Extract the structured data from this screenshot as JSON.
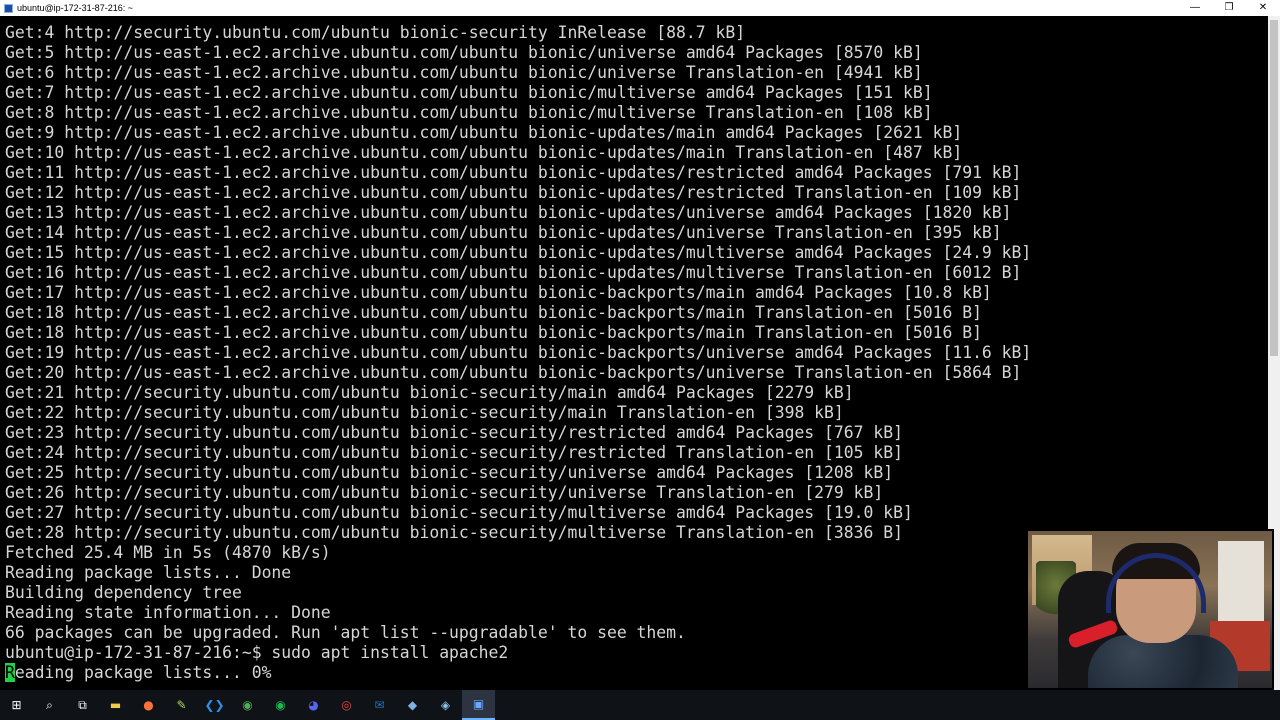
{
  "window": {
    "title": "ubuntu@ip-172-31-87-216: ~",
    "minimize": "—",
    "maximize": "❐",
    "close": "✕"
  },
  "terminal": {
    "lines": [
      "Get:4 http://security.ubuntu.com/ubuntu bionic-security InRelease [88.7 kB]",
      "Get:5 http://us-east-1.ec2.archive.ubuntu.com/ubuntu bionic/universe amd64 Packages [8570 kB]",
      "Get:6 http://us-east-1.ec2.archive.ubuntu.com/ubuntu bionic/universe Translation-en [4941 kB]",
      "Get:7 http://us-east-1.ec2.archive.ubuntu.com/ubuntu bionic/multiverse amd64 Packages [151 kB]",
      "Get:8 http://us-east-1.ec2.archive.ubuntu.com/ubuntu bionic/multiverse Translation-en [108 kB]",
      "Get:9 http://us-east-1.ec2.archive.ubuntu.com/ubuntu bionic-updates/main amd64 Packages [2621 kB]",
      "Get:10 http://us-east-1.ec2.archive.ubuntu.com/ubuntu bionic-updates/main Translation-en [487 kB]",
      "Get:11 http://us-east-1.ec2.archive.ubuntu.com/ubuntu bionic-updates/restricted amd64 Packages [791 kB]",
      "Get:12 http://us-east-1.ec2.archive.ubuntu.com/ubuntu bionic-updates/restricted Translation-en [109 kB]",
      "Get:13 http://us-east-1.ec2.archive.ubuntu.com/ubuntu bionic-updates/universe amd64 Packages [1820 kB]",
      "Get:14 http://us-east-1.ec2.archive.ubuntu.com/ubuntu bionic-updates/universe Translation-en [395 kB]",
      "Get:15 http://us-east-1.ec2.archive.ubuntu.com/ubuntu bionic-updates/multiverse amd64 Packages [24.9 kB]",
      "Get:16 http://us-east-1.ec2.archive.ubuntu.com/ubuntu bionic-updates/multiverse Translation-en [6012 B]",
      "Get:17 http://us-east-1.ec2.archive.ubuntu.com/ubuntu bionic-backports/main amd64 Packages [10.8 kB]",
      "Get:18 http://us-east-1.ec2.archive.ubuntu.com/ubuntu bionic-backports/main Translation-en [5016 B]",
      "Get:18 http://us-east-1.ec2.archive.ubuntu.com/ubuntu bionic-backports/main Translation-en [5016 B]",
      "Get:19 http://us-east-1.ec2.archive.ubuntu.com/ubuntu bionic-backports/universe amd64 Packages [11.6 kB]",
      "Get:20 http://us-east-1.ec2.archive.ubuntu.com/ubuntu bionic-backports/universe Translation-en [5864 B]",
      "Get:21 http://security.ubuntu.com/ubuntu bionic-security/main amd64 Packages [2279 kB]",
      "Get:22 http://security.ubuntu.com/ubuntu bionic-security/main Translation-en [398 kB]",
      "Get:23 http://security.ubuntu.com/ubuntu bionic-security/restricted amd64 Packages [767 kB]",
      "Get:24 http://security.ubuntu.com/ubuntu bionic-security/restricted Translation-en [105 kB]",
      "Get:25 http://security.ubuntu.com/ubuntu bionic-security/universe amd64 Packages [1208 kB]",
      "Get:26 http://security.ubuntu.com/ubuntu bionic-security/universe Translation-en [279 kB]",
      "Get:27 http://security.ubuntu.com/ubuntu bionic-security/multiverse amd64 Packages [19.0 kB]",
      "Get:28 http://security.ubuntu.com/ubuntu bionic-security/multiverse Translation-en [3836 B]",
      "Fetched 25.4 MB in 5s (4870 kB/s)",
      "Reading package lists... Done",
      "Building dependency tree",
      "Reading state information... Done",
      "66 packages can be upgraded. Run 'apt list --upgradable' to see them.",
      "ubuntu@ip-172-31-87-216:~$ sudo apt install apache2"
    ],
    "cursor_char": "R",
    "last_line_rest": "eading package lists... 0%",
    "text_color": "#d6d6d6",
    "cursor_color": "#22d04a"
  },
  "taskbar": {
    "items": [
      {
        "name": "start-button",
        "icon": "windows-logo-icon",
        "glyph": "⊞",
        "color": "#ffffff"
      },
      {
        "name": "search-button",
        "icon": "search-icon",
        "glyph": "⌕",
        "color": "#ffffff"
      },
      {
        "name": "task-view-button",
        "icon": "task-view-icon",
        "glyph": "⧉",
        "color": "#ffffff"
      },
      {
        "name": "file-explorer-button",
        "icon": "folder-icon",
        "glyph": "▬",
        "color": "#f2c94c"
      },
      {
        "name": "firefox-button",
        "icon": "firefox-icon",
        "glyph": "●",
        "color": "#ff7139"
      },
      {
        "name": "notepadpp-button",
        "icon": "notepad-icon",
        "glyph": "✎",
        "color": "#a5d66a"
      },
      {
        "name": "vscode-button",
        "icon": "vscode-icon",
        "glyph": "❮❯",
        "color": "#2f8fe5"
      },
      {
        "name": "chrome-button",
        "icon": "chrome-icon",
        "glyph": "◉",
        "color": "#4caf50"
      },
      {
        "name": "spotify-button",
        "icon": "spotify-icon",
        "glyph": "◉",
        "color": "#1db954"
      },
      {
        "name": "discord-button",
        "icon": "discord-icon",
        "glyph": "◕",
        "color": "#5865f2"
      },
      {
        "name": "obs-button",
        "icon": "record-icon",
        "glyph": "◎",
        "color": "#e84545"
      },
      {
        "name": "outlook-button",
        "icon": "mail-icon",
        "glyph": "✉",
        "color": "#1e73c8"
      },
      {
        "name": "app-button-1",
        "icon": "app-icon",
        "glyph": "◆",
        "color": "#7fb2e0"
      },
      {
        "name": "app-button-2",
        "icon": "network-icon",
        "glyph": "◈",
        "color": "#8fc0ea"
      },
      {
        "name": "putty-button",
        "icon": "terminal-icon",
        "glyph": "▣",
        "color": "#6fa8ff",
        "active": true
      }
    ]
  }
}
